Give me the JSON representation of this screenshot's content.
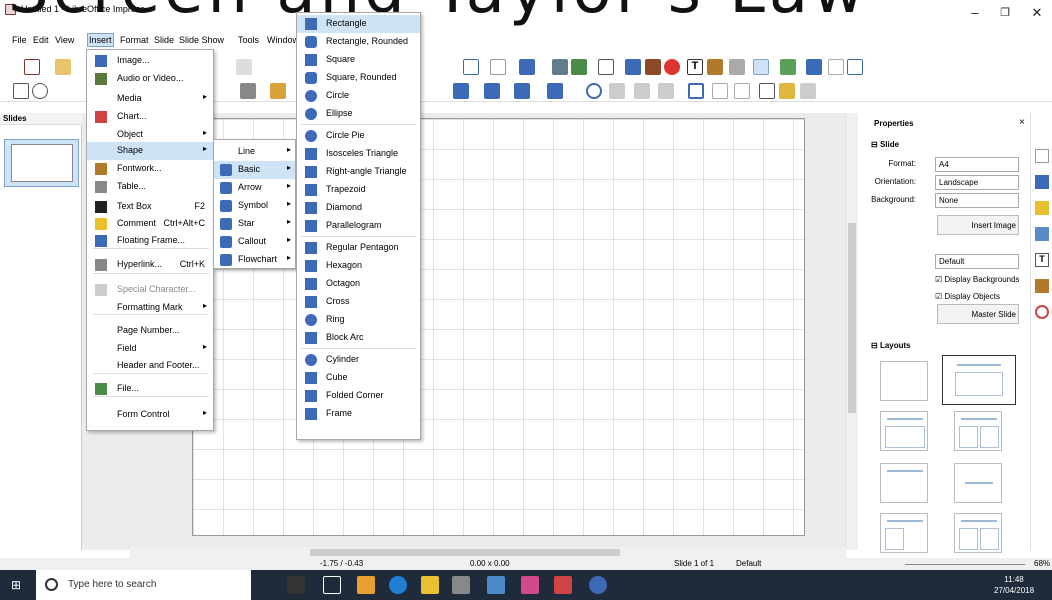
{
  "window": {
    "title": "Untitled 1 - LibreOffice Impress",
    "overlay_text": "Screen and Taylor's Law"
  },
  "menubar": [
    "File",
    "Edit",
    "View",
    "Insert",
    "Format",
    "Slide",
    "Slide Show",
    "Tools",
    "Window"
  ],
  "slides_panel": {
    "title": "Slides",
    "slide_number": "1"
  },
  "insert_menu": [
    {
      "label": "Image...",
      "shortcut": "",
      "submenu": false
    },
    {
      "label": "Audio or Video...",
      "shortcut": "",
      "submenu": false
    },
    {
      "label": "Media",
      "shortcut": "",
      "submenu": true
    },
    {
      "label": "Chart...",
      "shortcut": "",
      "submenu": false
    },
    {
      "label": "Object",
      "shortcut": "",
      "submenu": true
    },
    {
      "label": "Shape",
      "shortcut": "",
      "submenu": true
    },
    {
      "label": "Fontwork...",
      "shortcut": "",
      "submenu": false
    },
    {
      "label": "Table...",
      "shortcut": "",
      "submenu": false
    },
    {
      "label": "Text Box",
      "shortcut": "F2",
      "submenu": false
    },
    {
      "label": "Comment",
      "shortcut": "Ctrl+Alt+C",
      "submenu": false
    },
    {
      "label": "Floating Frame...",
      "shortcut": "",
      "submenu": false
    },
    {
      "label": "Hyperlink...",
      "shortcut": "Ctrl+K",
      "submenu": false
    },
    {
      "label": "Special Character...",
      "shortcut": "",
      "submenu": false
    },
    {
      "label": "Formatting Mark",
      "shortcut": "",
      "submenu": true
    },
    {
      "label": "Page Number...",
      "shortcut": "",
      "submenu": false
    },
    {
      "label": "Field",
      "shortcut": "",
      "submenu": true
    },
    {
      "label": "Header and Footer...",
      "shortcut": "",
      "submenu": false
    },
    {
      "label": "File...",
      "shortcut": "",
      "submenu": false
    },
    {
      "label": "Form Control",
      "shortcut": "",
      "submenu": true
    }
  ],
  "shape_menu": [
    "Line",
    "Basic",
    "Arrow",
    "Symbol",
    "Star",
    "Callout",
    "Flowchart"
  ],
  "basic_menu": [
    "Rectangle",
    "Rectangle, Rounded",
    "Square",
    "Square, Rounded",
    "Circle",
    "Ellipse",
    "Circle Pie",
    "Isosceles Triangle",
    "Right-angle Triangle",
    "Trapezoid",
    "Diamond",
    "Parallelogram",
    "Regular Pentagon",
    "Hexagon",
    "Octagon",
    "Cross",
    "Ring",
    "Block Arc",
    "Cylinder",
    "Cube",
    "Folded Corner",
    "Frame"
  ],
  "properties": {
    "title": "Properties",
    "slide_section": "Slide",
    "format_label": "Format:",
    "format_value": "A4",
    "orientation_label": "Orientation:",
    "orientation_value": "Landscape",
    "background_label": "Background:",
    "background_value": "None",
    "insert_image": "Insert Image",
    "master_value": "Default",
    "display_backgrounds": "Display Backgrounds",
    "display_objects": "Display Objects",
    "master_slide": "Master Slide",
    "layouts_section": "Layouts"
  },
  "statusbar": {
    "position": "-1.75 / -0.43",
    "size": "0.00 x 0.00",
    "slide": "Slide 1 of 1",
    "master": "Default",
    "zoom": "68%"
  },
  "taskbar": {
    "search_placeholder": "Type here to search",
    "time": "11:48",
    "date": "27/04/2018"
  },
  "colors": {
    "highlight": "#cfe3f7",
    "highlight_border": "#7da2ce",
    "taskbar": "#1f2a3a",
    "shape_blue": "#3d6ab6"
  }
}
